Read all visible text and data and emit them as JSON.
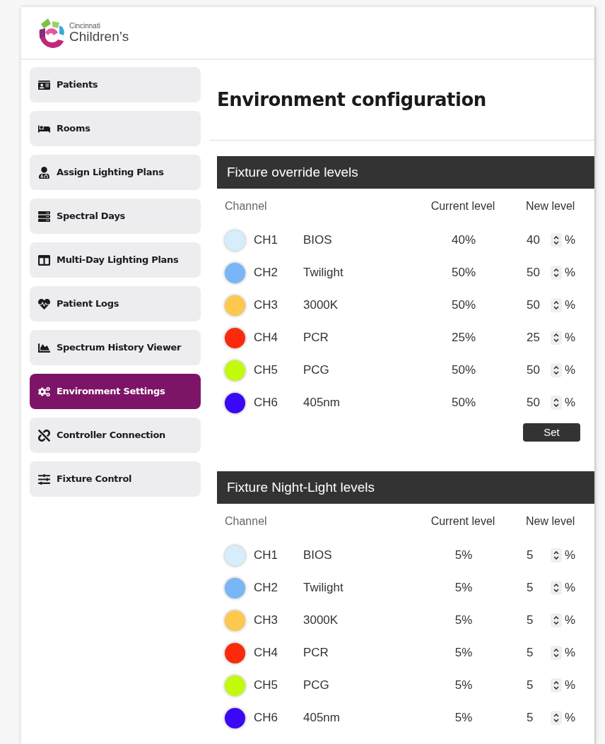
{
  "logo": {
    "line1": "Cincinnati",
    "line2": "Children’s"
  },
  "sidebar": {
    "items": [
      {
        "label": "Patients",
        "selected": false
      },
      {
        "label": "Rooms",
        "selected": false
      },
      {
        "label": "Assign Lighting Plans",
        "selected": false
      },
      {
        "label": "Spectral Days",
        "selected": false
      },
      {
        "label": "Multi-Day Lighting Plans",
        "selected": false
      },
      {
        "label": "Patient Logs",
        "selected": false
      },
      {
        "label": "Spectrum History Viewer",
        "selected": false
      },
      {
        "label": "Environment Settings",
        "selected": true
      },
      {
        "label": "Controller Connection",
        "selected": false
      },
      {
        "label": "Fixture Control",
        "selected": false
      }
    ]
  },
  "page_title": "Environment configuration",
  "sections": [
    {
      "title": "Fixture override levels",
      "columns": [
        "Channel",
        "Current level",
        "New level"
      ],
      "button": "Set",
      "rows": [
        {
          "channel": "CH1",
          "name": "BIOS",
          "color": "#d6eefb",
          "current": "40%",
          "new_value": "40",
          "unit": "%"
        },
        {
          "channel": "CH2",
          "name": "Twilight",
          "color": "#78b6f7",
          "current": "50%",
          "new_value": "50",
          "unit": "%"
        },
        {
          "channel": "CH3",
          "name": "3000K",
          "color": "#fdc84e",
          "current": "50%",
          "new_value": "50",
          "unit": "%"
        },
        {
          "channel": "CH4",
          "name": "PCR",
          "color": "#fb2a0c",
          "current": "25%",
          "new_value": "25",
          "unit": "%"
        },
        {
          "channel": "CH5",
          "name": "PCG",
          "color": "#c2fa0c",
          "current": "50%",
          "new_value": "50",
          "unit": "%"
        },
        {
          "channel": "CH6",
          "name": "405nm",
          "color": "#3a08f6",
          "current": "50%",
          "new_value": "50",
          "unit": "%"
        }
      ]
    },
    {
      "title": "Fixture Night-Light levels",
      "columns": [
        "Channel",
        "Current level",
        "New level"
      ],
      "rows": [
        {
          "channel": "CH1",
          "name": "BIOS",
          "color": "#d6eefb",
          "current": "5%",
          "new_value": "5",
          "unit": "%"
        },
        {
          "channel": "CH2",
          "name": "Twilight",
          "color": "#78b6f7",
          "current": "5%",
          "new_value": "5",
          "unit": "%"
        },
        {
          "channel": "CH3",
          "name": "3000K",
          "color": "#fdc84e",
          "current": "5%",
          "new_value": "5",
          "unit": "%"
        },
        {
          "channel": "CH4",
          "name": "PCR",
          "color": "#fb2a0c",
          "current": "5%",
          "new_value": "5",
          "unit": "%"
        },
        {
          "channel": "CH5",
          "name": "PCG",
          "color": "#c2fa0c",
          "current": "5%",
          "new_value": "5",
          "unit": "%"
        },
        {
          "channel": "CH6",
          "name": "405nm",
          "color": "#3a08f6",
          "current": "5%",
          "new_value": "5",
          "unit": "%"
        }
      ]
    }
  ]
}
